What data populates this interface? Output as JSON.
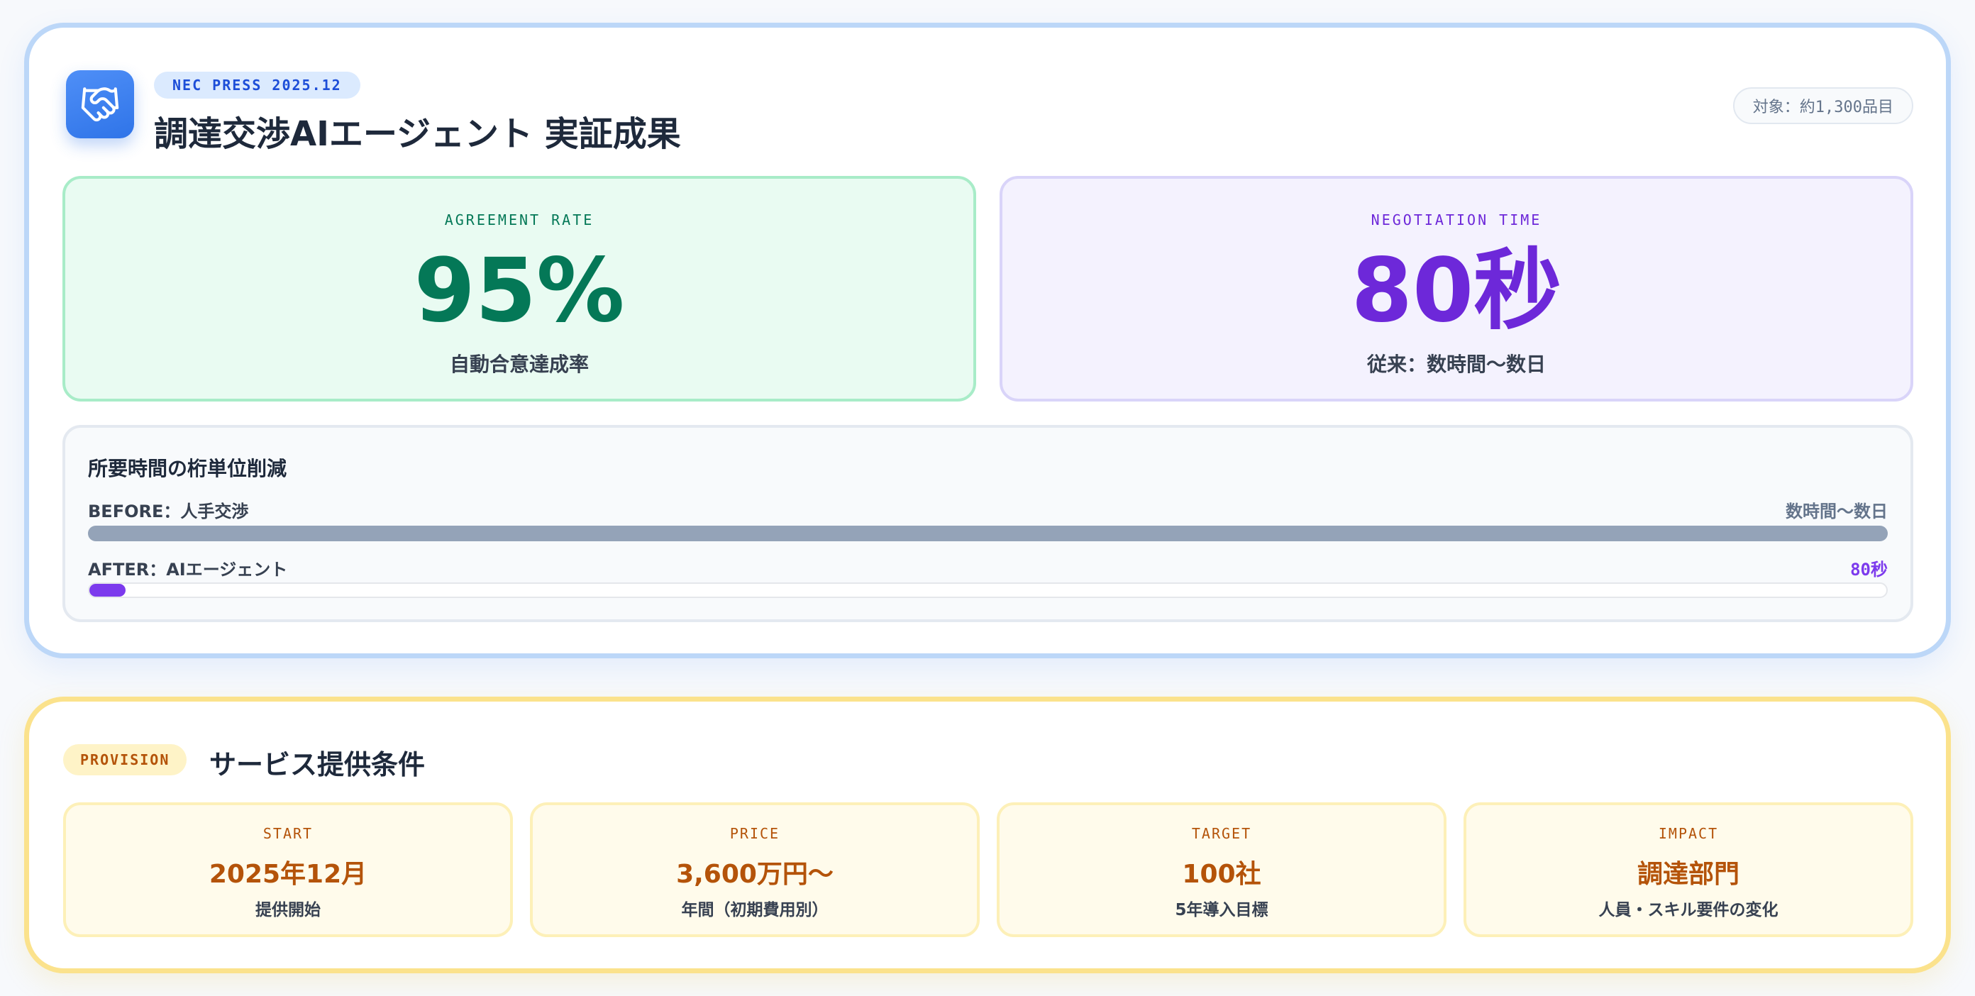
{
  "header": {
    "press_badge": "NEC PRESS 2025.12",
    "title": "調達交渉AIエージェント 実証成果",
    "target_pill": "対象：約1,300品目",
    "logo_icon": "handshake-icon"
  },
  "metrics": [
    {
      "label": "AGREEMENT RATE",
      "value": "95%",
      "sub": "自動合意達成率",
      "color": "#047857"
    },
    {
      "label": "NEGOTIATION TIME",
      "value": "80秒",
      "sub": "従来：数時間〜数日",
      "color": "#6d28d9"
    }
  ],
  "time_reduction": {
    "title": "所要時間の桁単位削減",
    "before": {
      "label": "BEFORE：人手交渉",
      "value": "数時間〜数日",
      "fill": 1.0
    },
    "after": {
      "label": "AFTER：AIエージェント",
      "value": "80秒",
      "fill": 0.02
    }
  },
  "provision": {
    "badge": "PROVISION",
    "title": "サービス提供条件",
    "items": [
      {
        "label": "START",
        "value": "2025年12月",
        "sub": "提供開始"
      },
      {
        "label": "PRICE",
        "value": "3,600万円〜",
        "sub": "年間（初期費用別）"
      },
      {
        "label": "TARGET",
        "value": "100社",
        "sub": "5年導入目標"
      },
      {
        "label": "IMPACT",
        "value": "調達部門",
        "sub": "人員・スキル要件の変化"
      }
    ]
  },
  "colors": {
    "primary": "#2f74e8",
    "green": "#047857",
    "purple": "#6d28d9",
    "amber": "#b45309"
  }
}
